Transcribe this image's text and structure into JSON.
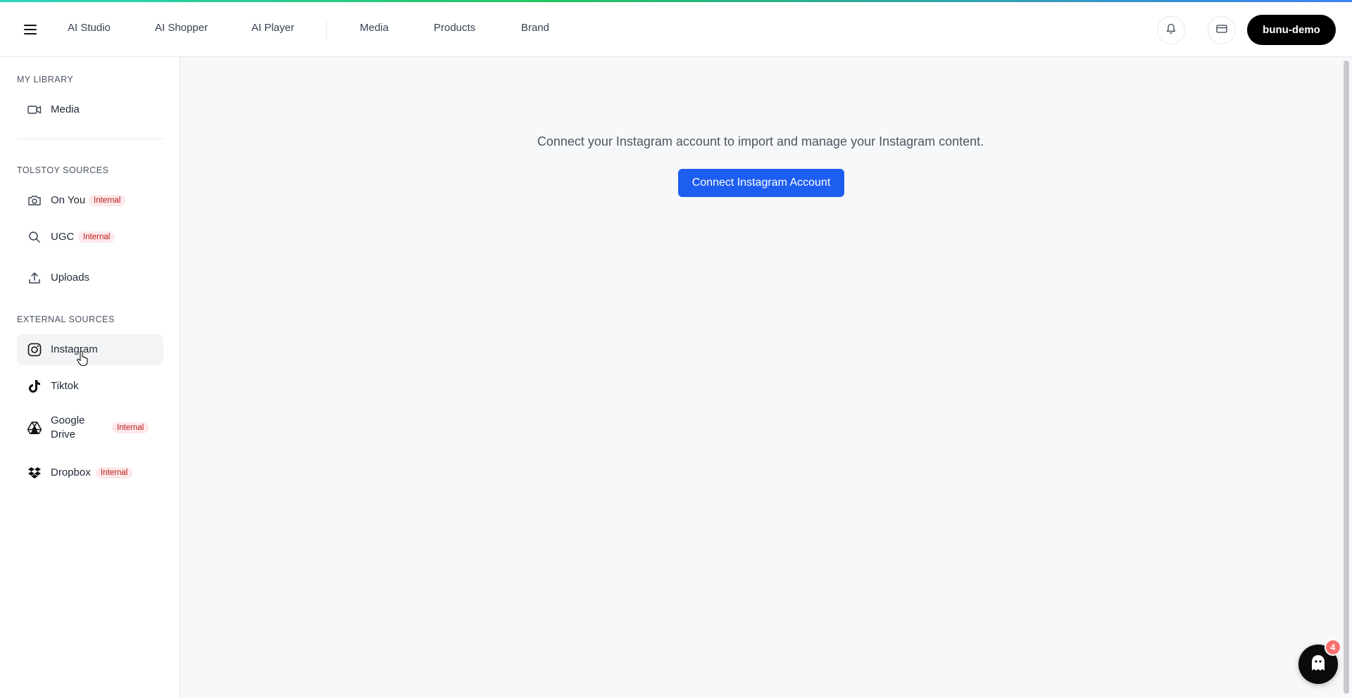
{
  "topbar": {
    "nav": [
      "AI Studio",
      "AI Shopper",
      "AI Player",
      "Media",
      "Products",
      "Brand"
    ],
    "account_label": "bunu-demo",
    "icons": {
      "menu": "hamburger-icon",
      "notifications": "bell-icon",
      "billing": "credit-card-icon"
    }
  },
  "sidebar": {
    "sections": {
      "library": "MY LIBRARY",
      "tolstoy": "TOLSTOY SOURCES",
      "external": "EXTERNAL SOURCES"
    },
    "items": {
      "media": {
        "label": "Media",
        "icon": "video-camera-icon"
      },
      "on_you": {
        "label": "On You",
        "icon": "camera-icon",
        "badge": "Internal"
      },
      "ugc": {
        "label": "UGC",
        "icon": "search-icon",
        "badge": "Internal"
      },
      "uploads": {
        "label": "Uploads",
        "icon": "upload-icon"
      },
      "instagram": {
        "label": "Instagram",
        "icon": "instagram-icon",
        "active": true
      },
      "tiktok": {
        "label": "Tiktok",
        "icon": "tiktok-icon"
      },
      "google_drive": {
        "label": "Google Drive",
        "icon": "google-drive-icon",
        "badge": "Internal"
      },
      "dropbox": {
        "label": "Dropbox",
        "icon": "dropbox-icon",
        "badge": "Internal"
      }
    }
  },
  "main": {
    "message": "Connect your Instagram account to import and manage your Instagram content.",
    "connect_button": "Connect Instagram Account"
  },
  "chat": {
    "count": "4",
    "icon": "ghost-chat-icon"
  },
  "colors": {
    "primary": "#1d5ef0",
    "badge_bg": "#fde8ea",
    "badge_text": "#b91c1c",
    "account_bg": "#000000",
    "main_bg": "#f7f8fa"
  }
}
